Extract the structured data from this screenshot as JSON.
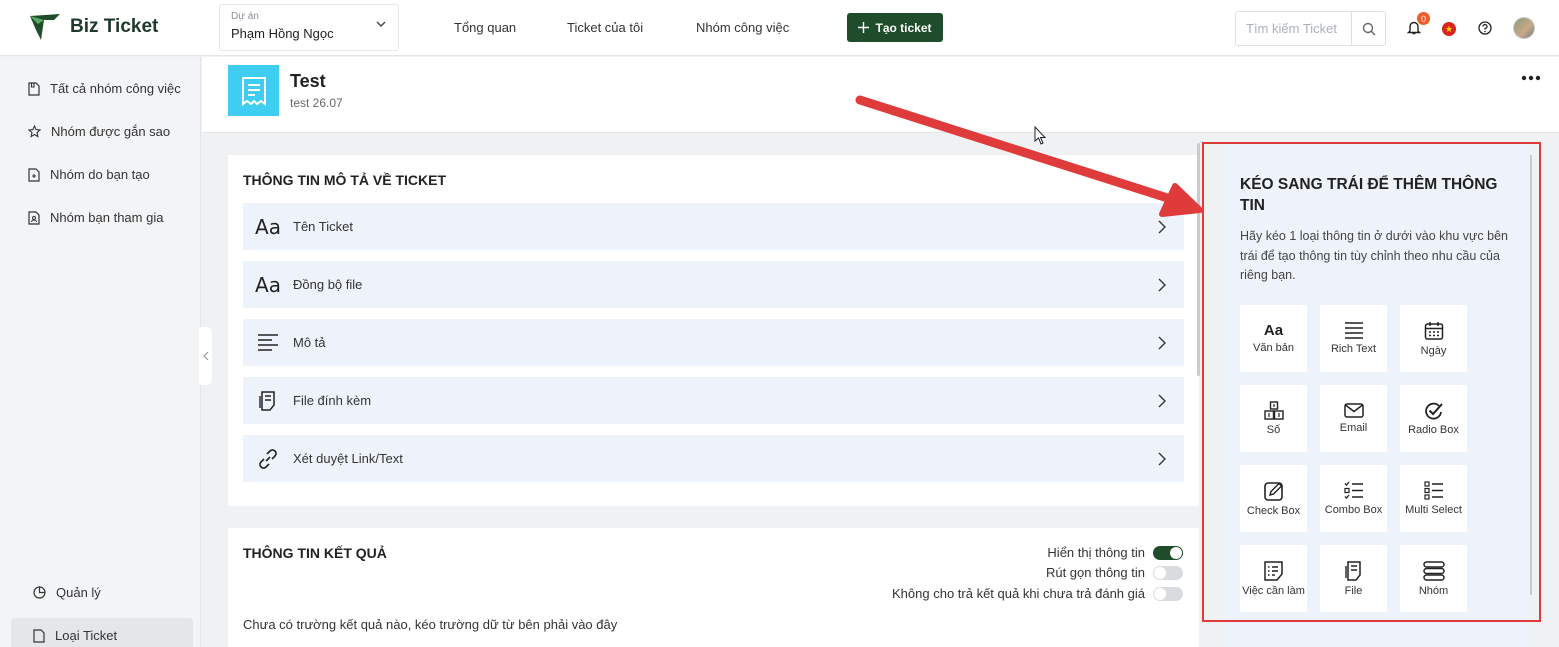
{
  "header": {
    "logo_text": "Biz Ticket",
    "project_label": "Dự án",
    "project_value": "Phạm Hồng Ngọc",
    "nav": [
      "Tổng quan",
      "Ticket của tôi",
      "Nhóm công việc"
    ],
    "create_label": "Tạo ticket",
    "search_placeholder": "Tìm kiếm Ticket",
    "notification_count": "0"
  },
  "sidebar": {
    "items": [
      {
        "label": "Tất cả nhóm công việc",
        "icon": "file-icon"
      },
      {
        "label": "Nhóm được gắn sao",
        "icon": "star-icon"
      },
      {
        "label": "Nhóm do bạn tạo",
        "icon": "file-plus-icon"
      },
      {
        "label": "Nhóm bạn tham gia",
        "icon": "file-user-icon"
      }
    ],
    "bottom_items": [
      {
        "label": "Quản lý",
        "icon": "chart-pie-icon"
      },
      {
        "label": "Loại Ticket",
        "icon": "file-icon"
      }
    ]
  },
  "page": {
    "title": "Test",
    "subtitle": "test 26.07"
  },
  "description_section": {
    "title": "THÔNG TIN MÔ TẢ VỀ TICKET",
    "fields": [
      {
        "label": "Tên Ticket",
        "icon": "text-aa-icon"
      },
      {
        "label": "Đồng bộ file",
        "icon": "text-aa-icon"
      },
      {
        "label": "Mô tả",
        "icon": "align-left-icon"
      },
      {
        "label": "File đính kèm",
        "icon": "attachment-icon"
      },
      {
        "label": "Xét duyệt Link/Text",
        "icon": "link-icon"
      }
    ]
  },
  "result_section": {
    "title": "THÔNG TIN KẾT QUẢ",
    "toggles": [
      {
        "label": "Hiển thị thông tin",
        "on": true
      },
      {
        "label": "Rút gọn thông tin",
        "on": false
      },
      {
        "label": "Không cho trả kết quả khi chưa trả đánh giá",
        "on": false
      }
    ],
    "empty_text": "Chưa có trường kết quả nào, kéo trường dữ từ bên phải vào đây"
  },
  "right_panel": {
    "title": "KÉO SANG TRÁI ĐỂ THÊM THÔNG TIN",
    "description": "Hãy kéo 1 loại thông tin ở dưới vào khu vực bên trái để tạo thông tin tùy chỉnh theo nhu cầu của riêng bạn.",
    "tiles": [
      {
        "label": "Văn bản",
        "icon": "text-aa-icon",
        "glyph": "Aa"
      },
      {
        "label": "Rich Text",
        "icon": "align-justify-icon"
      },
      {
        "label": "Ngày",
        "icon": "calendar-icon"
      },
      {
        "label": "Số",
        "icon": "number-blocks-icon"
      },
      {
        "label": "Email",
        "icon": "mail-icon"
      },
      {
        "label": "Radio Box",
        "icon": "check-circle-icon"
      },
      {
        "label": "Check Box",
        "icon": "edit-box-icon"
      },
      {
        "label": "Combo Box",
        "icon": "checklist-icon"
      },
      {
        "label": "Multi Select",
        "icon": "multi-list-icon"
      },
      {
        "label": "Việc cần làm",
        "icon": "todo-icon"
      },
      {
        "label": "File",
        "icon": "file-doc-icon"
      },
      {
        "label": "Nhóm",
        "icon": "stack-icon"
      }
    ]
  },
  "colors": {
    "brand": "#1f4d2b",
    "accent_cyan": "#3fcdf1",
    "highlight_red": "#e03b3b",
    "field_bg": "#eef3fb"
  }
}
